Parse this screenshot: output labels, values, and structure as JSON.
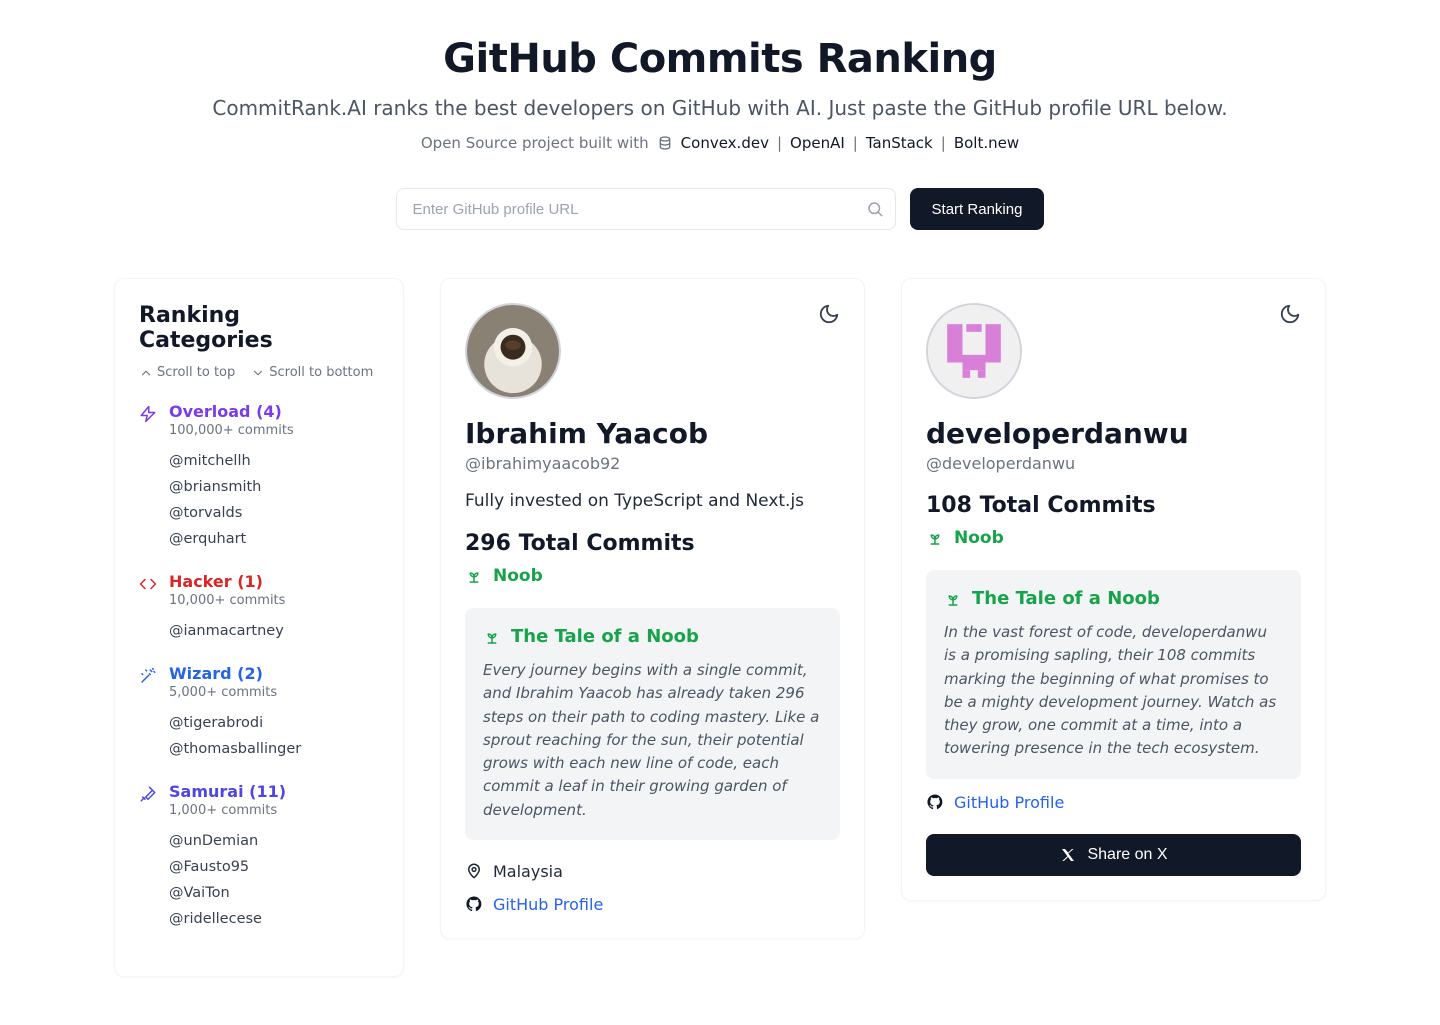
{
  "header": {
    "title": "GitHub Commits Ranking",
    "subtitle": "CommitRank.AI ranks the best developers on GitHub with AI. Just paste the GitHub profile URL below.",
    "built_with_prefix": "Open Source project built with",
    "credits": [
      "Convex.dev",
      "OpenAI",
      "TanStack",
      "Bolt.new"
    ]
  },
  "search": {
    "placeholder": "Enter GitHub profile URL",
    "button": "Start Ranking"
  },
  "sidebar": {
    "title": "Ranking Categories",
    "scroll_top": "Scroll to top",
    "scroll_bottom": "Scroll to bottom",
    "categories": [
      {
        "label": "Overload (4)",
        "sub": "100,000+ commits",
        "color": "#7c3aed",
        "icon": "zap",
        "users": [
          "@mitchellh",
          "@briansmith",
          "@torvalds",
          "@erquhart"
        ]
      },
      {
        "label": "Hacker (1)",
        "sub": "10,000+ commits",
        "color": "#dc2626",
        "icon": "code",
        "users": [
          "@ianmacartney"
        ]
      },
      {
        "label": "Wizard (2)",
        "sub": "5,000+ commits",
        "color": "#2563eb",
        "icon": "wand",
        "users": [
          "@tigerabrodi",
          "@thomasballinger"
        ]
      },
      {
        "label": "Samurai (11)",
        "sub": "1,000+ commits",
        "color": "#4f46e5",
        "icon": "sword",
        "users": [
          "@unDemian",
          "@Fausto95",
          "@VaiTon",
          "@ridellecese"
        ]
      }
    ]
  },
  "common": {
    "github_profile": "GitHub Profile",
    "share_on_x": "Share on X"
  },
  "profiles": [
    {
      "avatar": "coffee",
      "name": "Ibrahim Yaacob",
      "handle": "@ibrahimyaacob92",
      "bio": "Fully invested on TypeScript and Next.js",
      "commits_line": "296 Total Commits",
      "rank": "Noob",
      "tale_title": "The Tale of a Noob",
      "tale": "Every journey begins with a single commit, and Ibrahim Yaacob has already taken 296 steps on their path to coding mastery. Like a sprout reaching for the sun, their potential grows with each new line of code, each commit a leaf in their growing garden of development.",
      "location": "Malaysia"
    },
    {
      "avatar": "identicon",
      "name": "developerdanwu",
      "handle": "@developerdanwu",
      "bio": "",
      "commits_line": "108 Total Commits",
      "rank": "Noob",
      "tale_title": "The Tale of a Noob",
      "tale": "In the vast forest of code, developerdanwu is a promising sapling, their 108 commits marking the beginning of what promises to be a mighty development journey. Watch as they grow, one commit at a time, into a towering presence in the tech ecosystem.",
      "location": ""
    }
  ]
}
